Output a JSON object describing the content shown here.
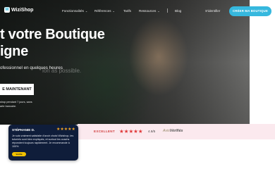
{
  "nav": {
    "logo": "WiziShop",
    "items": [
      "Fonctionnalités",
      "Références",
      "Tarifs",
      "Ressources",
      "Blog"
    ],
    "login": "S'identifier",
    "cta": "CRÉER MA BOUTIQUE"
  },
  "hero": {
    "title_line1": "t votre Boutique",
    "title_line2": "igne",
    "subtitle": "ofessionnel en quelques heures",
    "subtitle_ghost": "ion as possible.",
    "button": "E MAINTENANT",
    "note_line1": "shop pendant 7 jours, sans",
    "note_line2": "arte bancaire."
  },
  "reviews_band": {
    "label": "EXCELLENT",
    "stars": "★★★★★",
    "score": "4.8/5",
    "brand_prefix": "Avis",
    "brand_name": "Vérifiés"
  },
  "testimonial": {
    "name": "STÉPHANIE D.",
    "stars": "★★★★★",
    "text": "Je suis vraiment satisfaite d'avoir choisi Wizishop, les tutoriels sont bien expliqués, et surtout les coachs répondent toujours rapidement. Je recommande à 100%",
    "badge": "Vérifié"
  },
  "colors": {
    "accent": "#36b8de",
    "card_bg": "#0f1d3a",
    "band_bg": "#fbe9ee",
    "band_stars": "#e03a3a"
  }
}
